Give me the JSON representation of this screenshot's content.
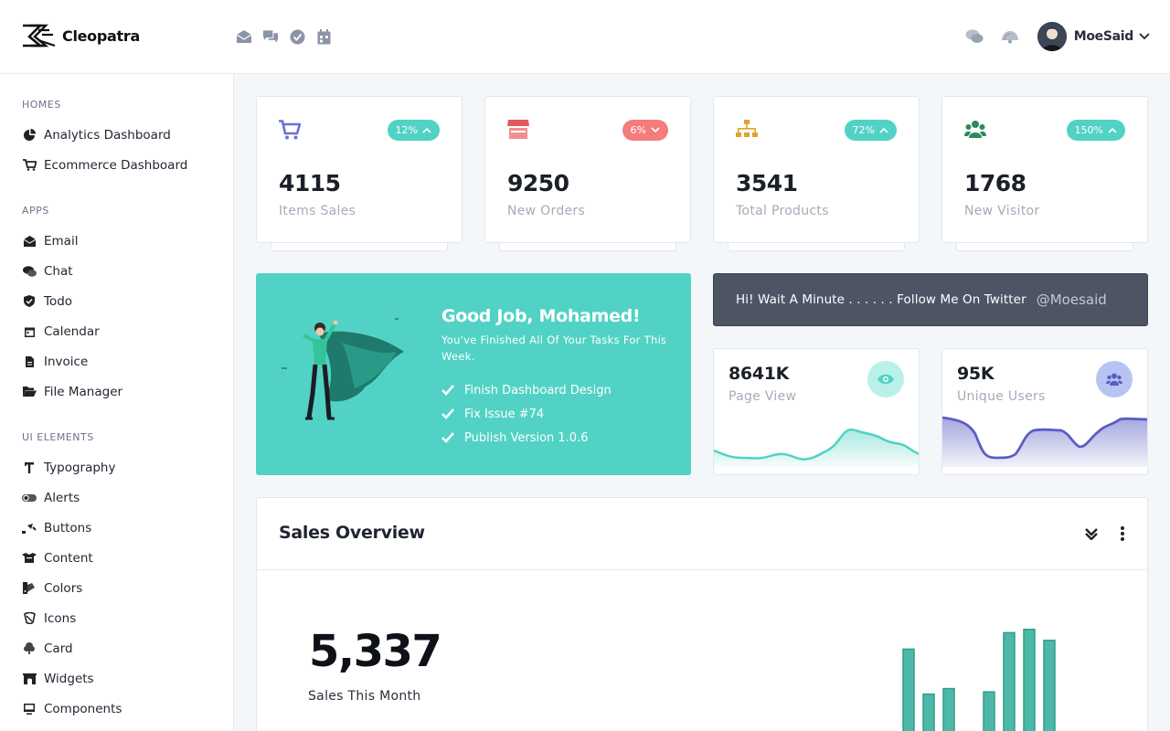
{
  "brand": {
    "name": "Cleopatra"
  },
  "top_icons": [
    "email-icon",
    "chat-icon",
    "todo-check-icon",
    "calendar-icon"
  ],
  "top_right_icons": [
    "messages-icon",
    "notifications-icon"
  ],
  "user": {
    "name": "MoeSaid"
  },
  "sidebar": {
    "sections": [
      {
        "title": "HOMES",
        "items": [
          {
            "label": "Analytics Dashboard",
            "icon": "pie-chart-icon"
          },
          {
            "label": "Ecommerce Dashboard",
            "icon": "cart-icon"
          }
        ]
      },
      {
        "title": "APPS",
        "items": [
          {
            "label": "Email",
            "icon": "envelope-icon"
          },
          {
            "label": "Chat",
            "icon": "comments-icon"
          },
          {
            "label": "Todo",
            "icon": "shield-check-icon"
          },
          {
            "label": "Calendar",
            "icon": "calendar-icon"
          },
          {
            "label": "Invoice",
            "icon": "file-invoice-icon"
          },
          {
            "label": "File Manager",
            "icon": "folder-open-icon"
          }
        ]
      },
      {
        "title": "UI ELEMENTS",
        "items": [
          {
            "label": "Typography",
            "icon": "text-icon"
          },
          {
            "label": "Alerts",
            "icon": "toggle-icon"
          },
          {
            "label": "Buttons",
            "icon": "pointer-icon"
          },
          {
            "label": "Content",
            "icon": "box-icon"
          },
          {
            "label": "Colors",
            "icon": "palette-icon"
          },
          {
            "label": "Icons",
            "icon": "hat-icon"
          },
          {
            "label": "Card",
            "icon": "tree-icon"
          },
          {
            "label": "Widgets",
            "icon": "archway-icon"
          },
          {
            "label": "Components",
            "icon": "desktop-icon"
          }
        ]
      }
    ]
  },
  "stats": [
    {
      "value": "4115",
      "label": "Items Sales",
      "badge": "12%",
      "trend": "up",
      "badge_color": "#51d2c4",
      "icon": "cart-icon",
      "icon_color": "#6b6fd9"
    },
    {
      "value": "9250",
      "label": "New Orders",
      "badge": "6%",
      "trend": "down",
      "badge_color": "#f47c7c",
      "icon": "store-icon",
      "icon_color": "#e25a5a"
    },
    {
      "value": "3541",
      "label": "Total Products",
      "badge": "72%",
      "trend": "up",
      "badge_color": "#51d2c4",
      "icon": "sitemap-icon",
      "icon_color": "#e0a42c"
    },
    {
      "value": "1768",
      "label": "New Visitor",
      "badge": "150%",
      "trend": "up",
      "badge_color": "#51d2c4",
      "icon": "users-icon",
      "icon_color": "#2f8a5b"
    }
  ],
  "congrats": {
    "title": "Good Job, Mohamed!",
    "subtitle": "You've Finished All Of Your Tasks For This Week.",
    "tasks": [
      "Finish Dashboard Design",
      "Fix Issue #74",
      "Publish Version 1.0.6"
    ]
  },
  "twitter": {
    "message": "Hi! Wait A Minute . . . . . . Follow Me On Twitter",
    "handle": "@Moesaid"
  },
  "mini_stats": [
    {
      "value": "8641K",
      "label": "Page View",
      "icon": "eye-icon",
      "color": "#51d2c4",
      "bg": "#b9f0ea"
    },
    {
      "value": "95K",
      "label": "Unique Users",
      "icon": "users-icon",
      "color": "#5a5ec4",
      "bg": "#b7c4f3"
    }
  ],
  "sales_overview": {
    "title": "Sales Overview",
    "value": "5,337",
    "value_label": "Sales This Month",
    "bar_color": "#4db8a7"
  },
  "chart_data": {
    "type": "bar",
    "values": [
      88,
      47,
      52,
      0,
      49,
      103,
      106,
      96
    ]
  }
}
